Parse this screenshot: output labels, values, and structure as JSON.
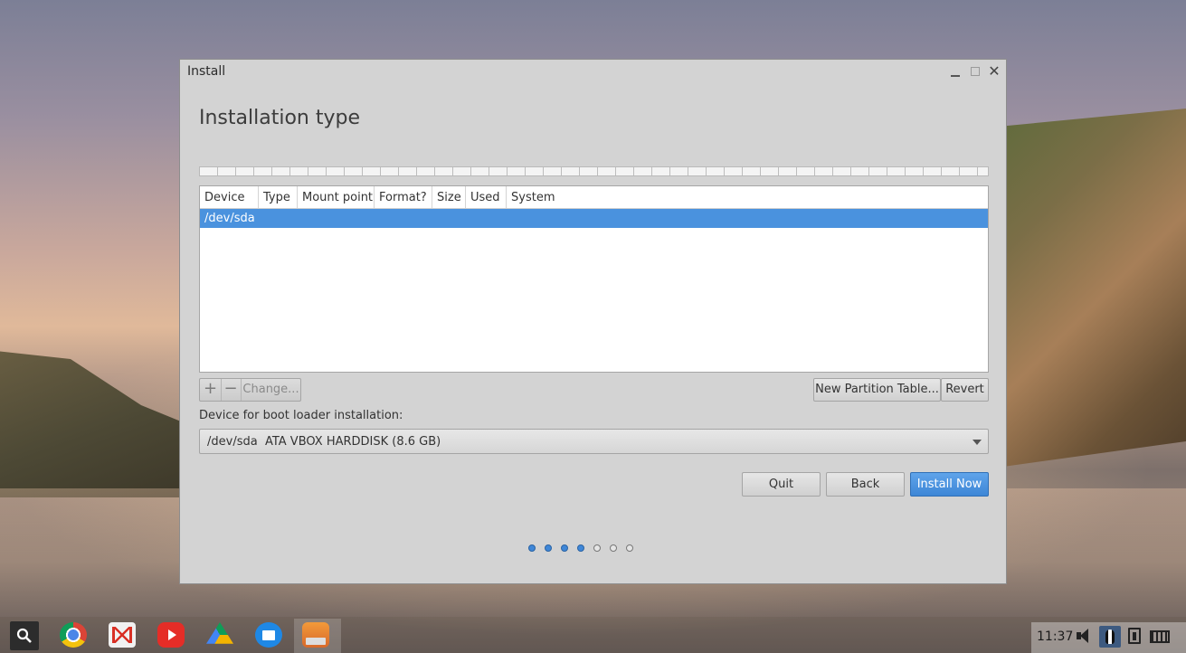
{
  "window": {
    "title": "Install",
    "close_glyph": "✕"
  },
  "page": {
    "title": "Installation type"
  },
  "partition_table": {
    "columns": [
      "Device",
      "Type",
      "Mount point",
      "Format?",
      "Size",
      "Used",
      "System"
    ],
    "rows": [
      {
        "device": "/dev/sda",
        "selected": true
      }
    ]
  },
  "partition_buttons": {
    "add": "+",
    "remove": "−",
    "change": "Change...",
    "new_table": "New Partition Table...",
    "revert": "Revert"
  },
  "bootloader": {
    "label": "Device for boot loader installation:",
    "selected": "/dev/sda  ATA VBOX HARDDISK (8.6 GB)"
  },
  "actions": {
    "quit": "Quit",
    "back": "Back",
    "install": "Install Now"
  },
  "progress": {
    "total_steps": 7,
    "completed_steps": 4
  },
  "taskbar": {
    "apps": [
      "launcher-search-icon",
      "chrome-icon",
      "gmail-icon",
      "youtube-icon",
      "drive-icon",
      "files-icon",
      "installer-icon"
    ],
    "clock": "11:37"
  },
  "colors": {
    "accent": "#4a92de",
    "window_bg": "#d3d3d3"
  }
}
